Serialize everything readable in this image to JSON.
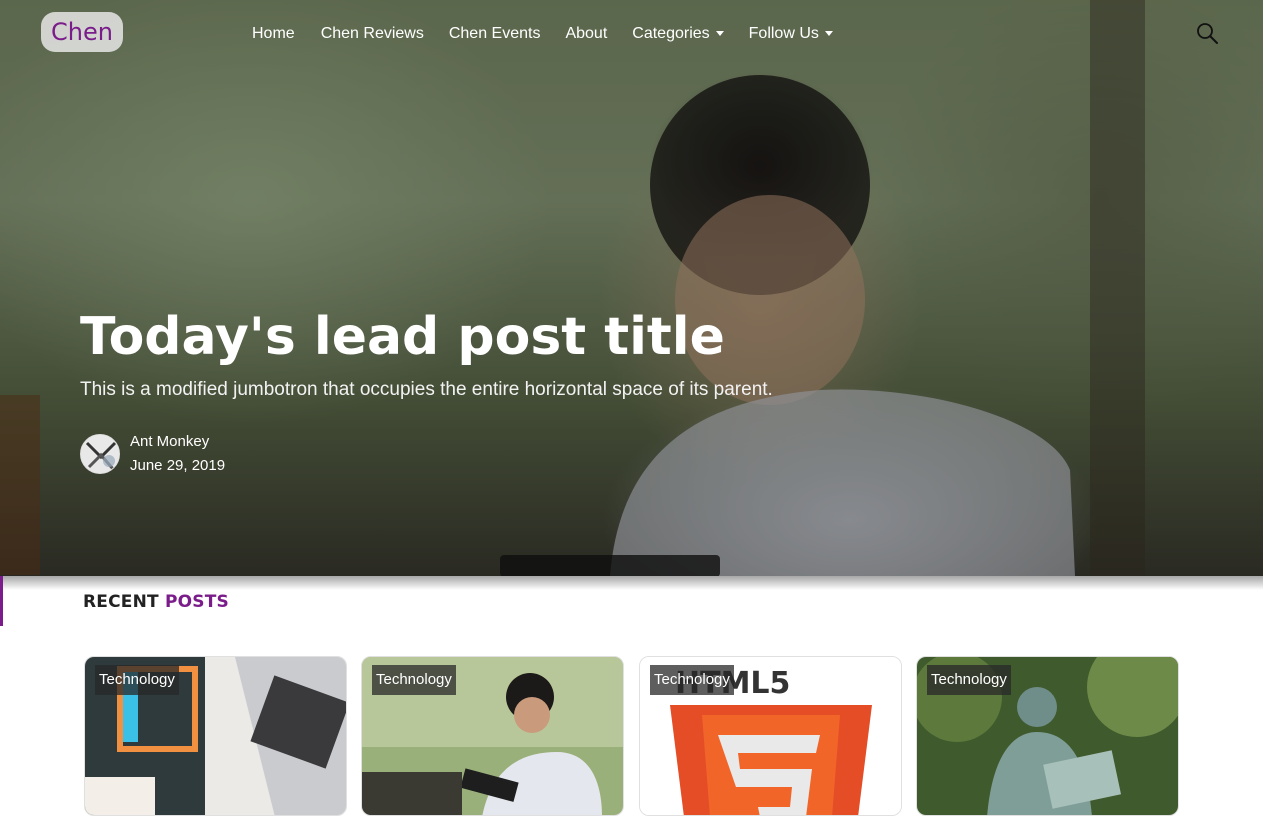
{
  "brand": {
    "label": "Chen"
  },
  "nav": {
    "items": [
      {
        "label": "Home"
      },
      {
        "label": "Chen Reviews"
      },
      {
        "label": "Chen Events"
      },
      {
        "label": "About"
      },
      {
        "label": "Categories",
        "dropdown": true
      },
      {
        "label": "Follow Us",
        "dropdown": true
      }
    ]
  },
  "hero": {
    "title": "Today's lead post title",
    "lead": "This is a modified jumbotron that occupies the entire horizontal space of its parent.",
    "author": "Ant Monkey",
    "date": "June 29, 2019"
  },
  "recent": {
    "title_part1": "RECENT",
    "title_part2": "POSTS",
    "cards": [
      {
        "category": "Technology",
        "image": "laptop-desk"
      },
      {
        "category": "Technology",
        "image": "man-with-tablet"
      },
      {
        "category": "Technology",
        "image": "html5-logo"
      },
      {
        "category": "Technology",
        "image": "statue"
      }
    ]
  },
  "colors": {
    "accent": "#7a1c8a",
    "brand_bg": "#e6e6e6"
  }
}
